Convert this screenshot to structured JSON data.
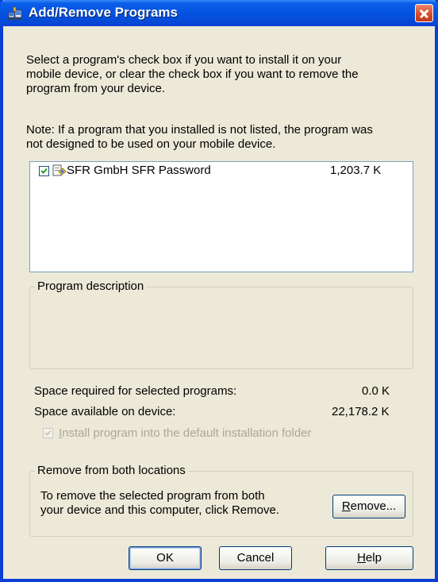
{
  "window": {
    "title": "Add/Remove Programs"
  },
  "instructions": {
    "line1": "Select a program's check box if you want to install it on your",
    "line2": "mobile device, or clear the check box if you want to remove the",
    "line3": "program from your device."
  },
  "note": {
    "line1": "Note:  If a program that you installed is not listed, the program was",
    "line2": "not designed to be used on your mobile device."
  },
  "programs": [
    {
      "name": "SFR GmbH SFR Password",
      "size": "1,203.7 K",
      "checked": true
    }
  ],
  "description_group": {
    "legend": "Program description"
  },
  "space": {
    "required_label": "Space required for selected programs:",
    "required_value": "0.0 K",
    "available_label": "Space available on device:",
    "available_value": "22,178.2 K"
  },
  "install_default": {
    "label_u": "I",
    "label_rest": "nstall program into the default installation folder",
    "checked": true,
    "enabled": false
  },
  "remove_group": {
    "legend": "Remove from both locations",
    "line1": "To remove the selected program from both",
    "line2": "your device and this computer, click Remove.",
    "button_u": "R",
    "button_rest": "emove..."
  },
  "buttons": {
    "ok": "OK",
    "cancel": "Cancel",
    "help_u": "H",
    "help_rest": "elp"
  },
  "icons": {
    "title": "add-remove-programs-icon",
    "program": "setup-package-icon",
    "close": "close-icon"
  }
}
